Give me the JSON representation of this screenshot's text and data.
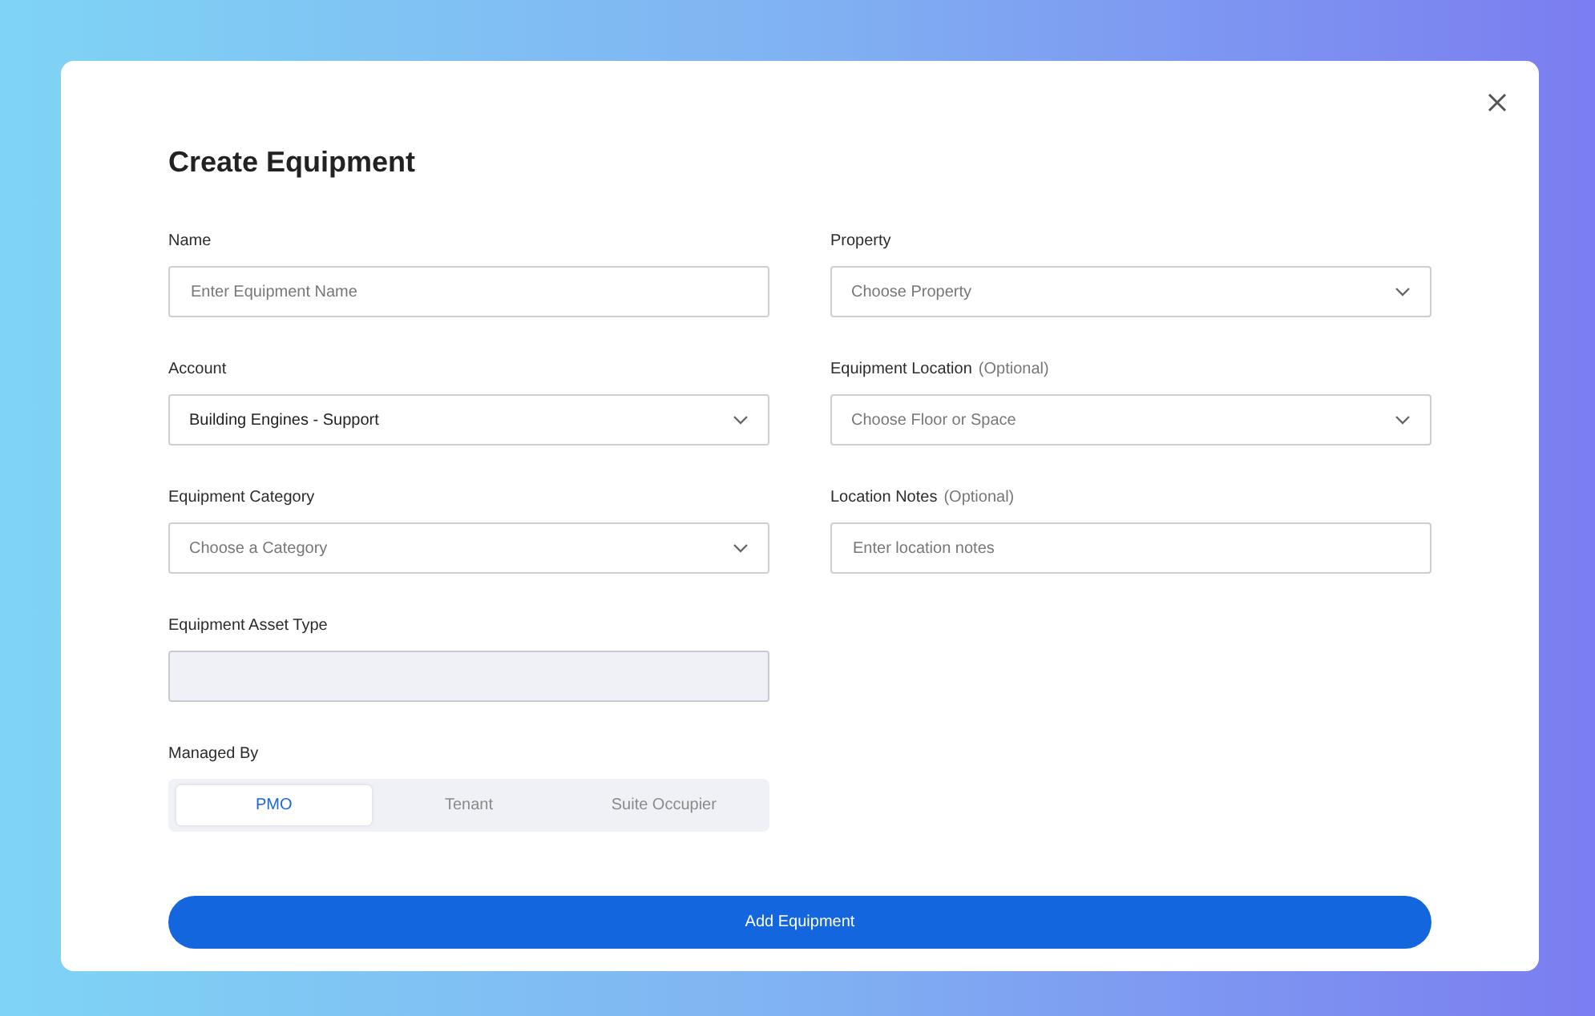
{
  "dialog": {
    "title": "Create Equipment",
    "left_fields": [
      {
        "kind": "text",
        "label": "Name",
        "placeholder": "Enter Equipment Name"
      },
      {
        "kind": "select",
        "label": "Account",
        "value": "Building Engines - Support"
      },
      {
        "kind": "select",
        "label": "Equipment Category",
        "placeholder": "Choose a Category"
      },
      {
        "kind": "disabled",
        "label": "Equipment Asset Type"
      },
      {
        "kind": "segmented",
        "label": "Managed By",
        "options": [
          {
            "label": "PMO",
            "selected": true
          },
          {
            "label": "Tenant",
            "selected": false
          },
          {
            "label": "Suite Occupier",
            "selected": false
          }
        ]
      }
    ],
    "right_fields": [
      {
        "kind": "select",
        "label": "Property",
        "placeholder": "Choose Property"
      },
      {
        "kind": "select",
        "label": "Equipment Location",
        "note": "(Optional)",
        "placeholder": "Choose Floor or Space"
      },
      {
        "kind": "text",
        "label": "Location Notes",
        "note": "(Optional)",
        "placeholder": "Enter location notes"
      }
    ],
    "submit": "Add Equipment"
  }
}
